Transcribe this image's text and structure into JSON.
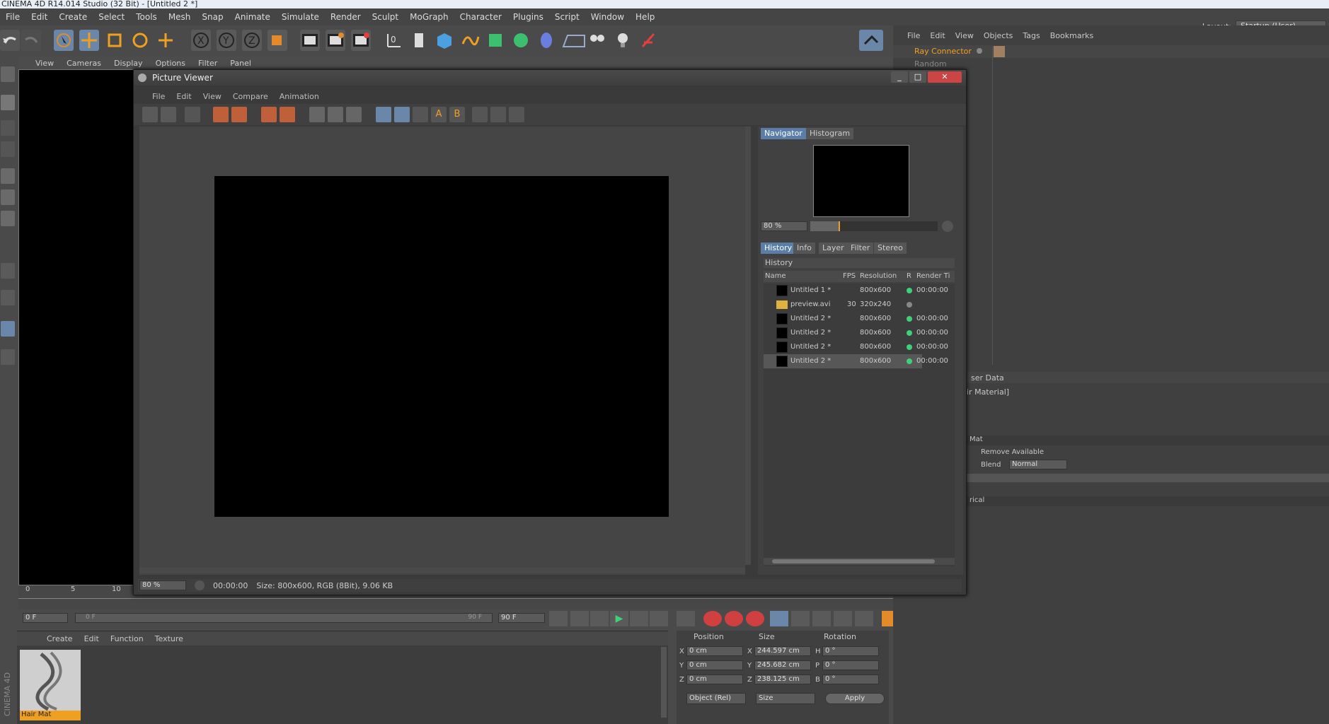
{
  "app": {
    "title": "CINEMA 4D R14.014 Studio (32 Bit) - [Untitled 2 *]"
  },
  "menu": [
    "File",
    "Edit",
    "Create",
    "Select",
    "Tools",
    "Mesh",
    "Snap",
    "Animate",
    "Simulate",
    "Render",
    "Sculpt",
    "MoGraph",
    "Character",
    "Plugins",
    "Script",
    "Window",
    "Help"
  ],
  "layout": {
    "label": "Layout:",
    "value": "Startup (User)"
  },
  "viewport_menu": [
    "View",
    "Cameras",
    "Display",
    "Options",
    "Filter",
    "Panel"
  ],
  "objmgr": {
    "menu": [
      "File",
      "Edit",
      "View",
      "Objects",
      "Tags",
      "Bookmarks"
    ],
    "items": [
      "Ray Connector",
      "Random"
    ]
  },
  "attr": {
    "title_partial": "ser Data",
    "subtitle_partial": "ir Material]",
    "mat_partial": "Mat",
    "remove_available": "Remove Available",
    "blend_label": "Blend",
    "blend_value": "Normal",
    "rical": "rical"
  },
  "pv": {
    "title": "Picture Viewer",
    "menu": [
      "File",
      "Edit",
      "View",
      "Compare",
      "Animation"
    ],
    "tabs": [
      "Navigator",
      "Histogram"
    ],
    "nav_zoom": "80 %",
    "subtabs": [
      "History",
      "Info",
      "Layer",
      "Filter",
      "Stereo"
    ],
    "history_title": "History",
    "columns": [
      "Name",
      "FPS",
      "Resolution",
      "R",
      "Render Ti"
    ],
    "rows": [
      {
        "name": "Untitled 1 *",
        "fps": "",
        "res": "800x600",
        "status": "green",
        "time": "00:00:00"
      },
      {
        "name": "preview.avi",
        "fps": "30",
        "res": "320x240",
        "status": "gray",
        "time": ""
      },
      {
        "name": "Untitled 2 *",
        "fps": "",
        "res": "800x600",
        "status": "green",
        "time": "00:00:00"
      },
      {
        "name": "Untitled 2 *",
        "fps": "",
        "res": "800x600",
        "status": "green",
        "time": "00:00:00"
      },
      {
        "name": "Untitled 2 *",
        "fps": "",
        "res": "800x600",
        "status": "green",
        "time": "00:00:00"
      },
      {
        "name": "Untitled 2 *",
        "fps": "",
        "res": "800x600",
        "status": "green",
        "time": "00:00:00"
      }
    ],
    "status": {
      "zoom": "80 %",
      "time": "00:00:00",
      "info": "Size: 800x600, RGB (8Bit), 9.06 KB"
    }
  },
  "timeline": {
    "ticks": [
      "0",
      "5",
      "10"
    ],
    "frame_start": "0 F",
    "range_left": "0 F",
    "range_right": "90 F",
    "frame_end": "90 F"
  },
  "matmgr": {
    "menu": [
      "Create",
      "Edit",
      "Function",
      "Texture"
    ],
    "material": "Hair Mat",
    "side_label": "CINEMA 4D"
  },
  "coords": {
    "headers": [
      "Position",
      "Size",
      "Rotation"
    ],
    "rows": [
      {
        "axis": "X",
        "pos": "0 cm",
        "saxis": "X",
        "size": "244.597 cm",
        "raxis": "H",
        "rot": "0 °"
      },
      {
        "axis": "Y",
        "pos": "0 cm",
        "saxis": "Y",
        "size": "245.682 cm",
        "raxis": "P",
        "rot": "0 °"
      },
      {
        "axis": "Z",
        "pos": "0 cm",
        "saxis": "Z",
        "size": "238.125 cm",
        "raxis": "B",
        "rot": "0 °"
      }
    ],
    "mode": "Object (Rel)",
    "size_mode": "Size",
    "apply": "Apply"
  },
  "colors": {
    "accent": "#5a7ea8",
    "orange": "#f0a020",
    "green": "#3fd07a"
  }
}
